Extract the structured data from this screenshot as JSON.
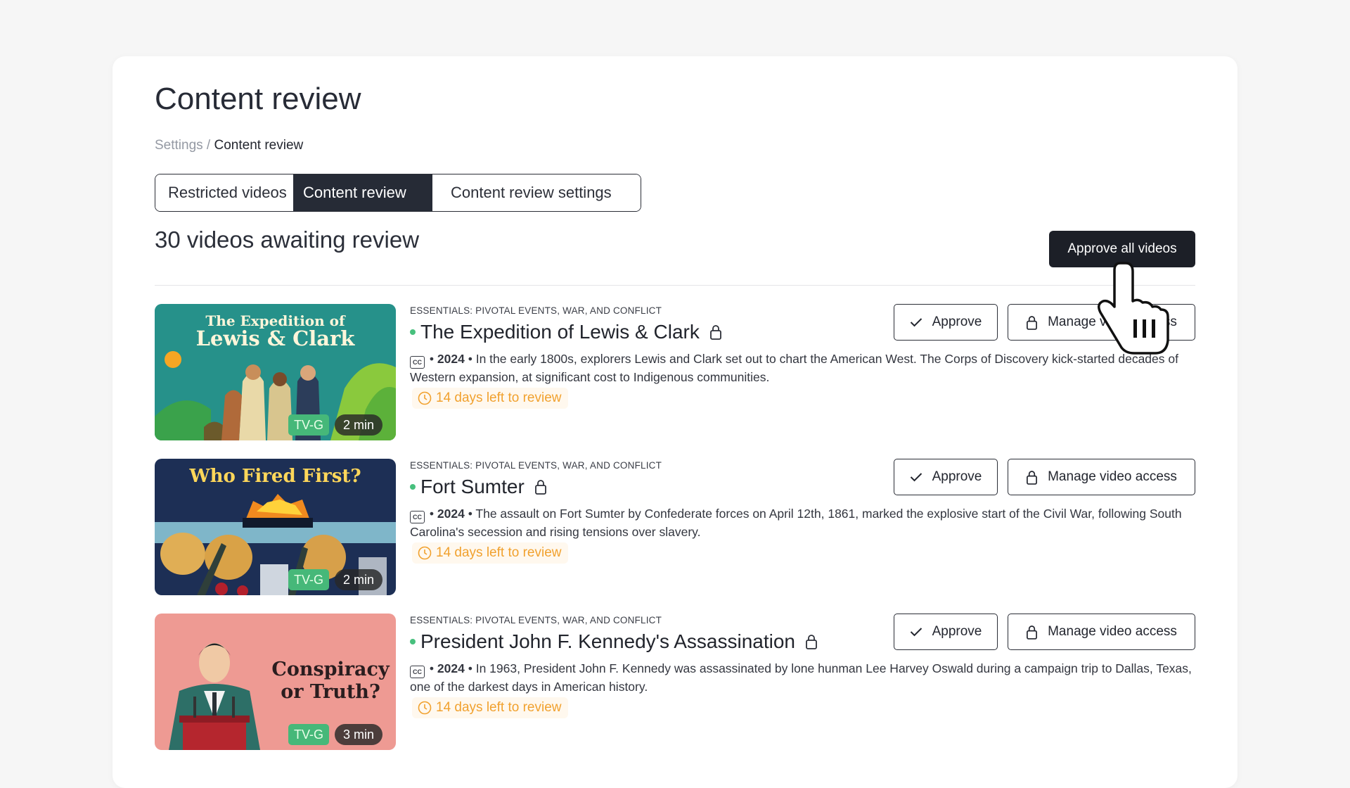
{
  "page": {
    "title": "Content review",
    "breadcrumb": {
      "parent": "Settings",
      "separator": " / ",
      "current": "Content review"
    },
    "tabs": [
      {
        "label": "Restricted videos",
        "active": false
      },
      {
        "label": "Content review",
        "active": true
      },
      {
        "label": "Content review settings",
        "active": false
      }
    ],
    "awaiting_heading": "30 videos awaiting review",
    "approve_all_label": "Approve all videos"
  },
  "videos": [
    {
      "thumb_title_line1": "The Expedition of",
      "thumb_title_line2": "Lewis & Clark",
      "rating": "TV-G",
      "duration": "2 min",
      "category": "ESSENTIALS: PIVOTAL EVENTS, WAR, AND CONFLICT",
      "title": "The Expedition of Lewis & Clark",
      "cc": "CC",
      "year": "2024",
      "bullet": "•",
      "description": "In the early 1800s, explorers Lewis and Clark set out to chart the American West. The Corps of Discovery kick-started decades of Western expansion, at significant cost to Indigenous communities.",
      "review_left": "14 days left to review",
      "approve_label": "Approve",
      "manage_label": "Manage video access"
    },
    {
      "thumb_title_line1": "Who Fired First?",
      "rating": "TV-G",
      "duration": "2 min",
      "category": "ESSENTIALS: PIVOTAL EVENTS, WAR, AND CONFLICT",
      "title": "Fort Sumter",
      "cc": "CC",
      "year": "2024",
      "bullet": "•",
      "description": "The assault on Fort Sumter by Confederate forces on April 12th, 1861, marked the explosive start of the Civil War, following South Carolina's secession and rising tensions over slavery.",
      "review_left": "14 days left to review",
      "approve_label": "Approve",
      "manage_label": "Manage video access"
    },
    {
      "thumb_title_line1": "Conspiracy",
      "thumb_title_line2": "or Truth?",
      "rating": "TV-G",
      "duration": "3 min",
      "category": "ESSENTIALS: PIVOTAL EVENTS, WAR, AND CONFLICT",
      "title": "President John F. Kennedy's Assassination",
      "cc": "CC",
      "year": "2024",
      "bullet": "•",
      "description": "In 1963, President John F. Kennedy was assassinated by lone hunman Lee Harvey Oswald during a campaign trip to Dallas, Texas, one of the darkest days in American history.",
      "review_left": "14 days left to review",
      "approve_label": "Approve",
      "manage_label": "Manage video access"
    }
  ],
  "colors": {
    "accent_dark": "#1c1f27",
    "status_green": "#47c07d",
    "review_orange": "#f1a12e",
    "rating_green": "#46b879"
  },
  "icons": [
    "lock-icon",
    "check-icon",
    "clock-icon",
    "closed-captions-icon",
    "hand-pointer-cursor-icon"
  ]
}
